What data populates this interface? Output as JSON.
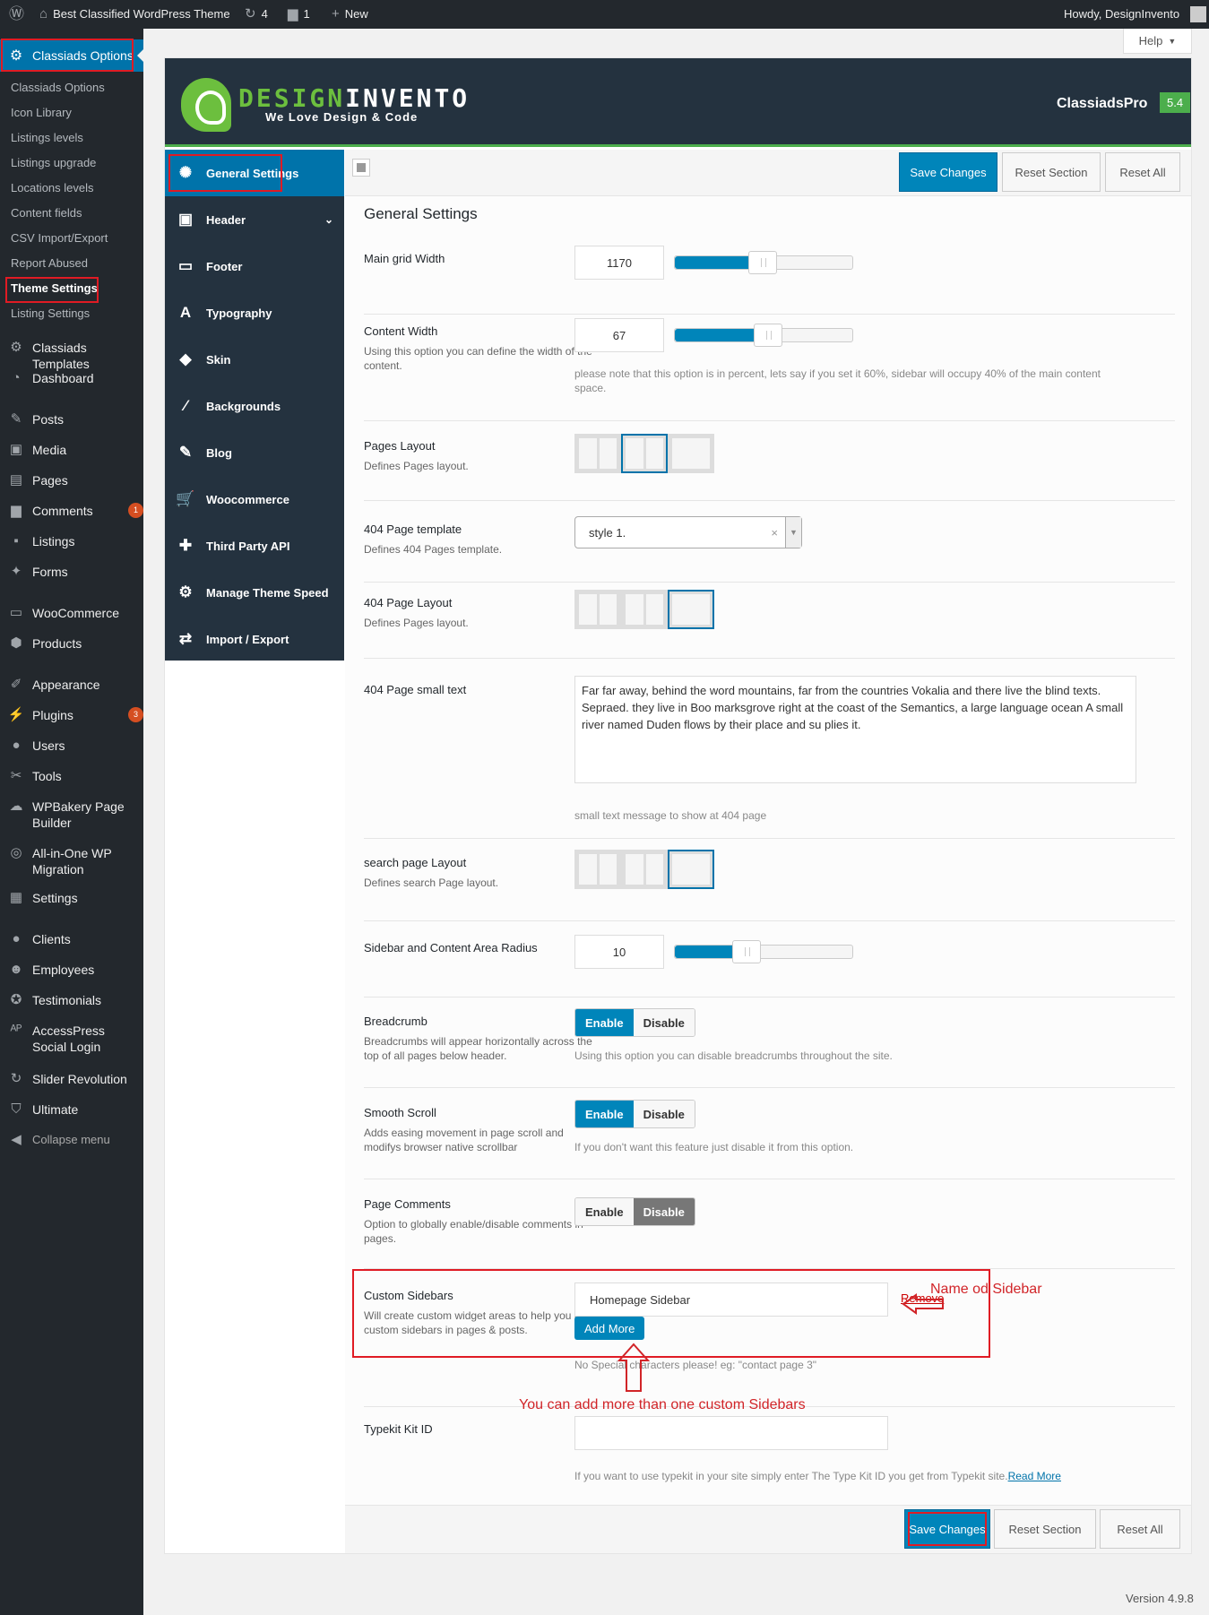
{
  "adminbar": {
    "site_name": "Best Classified WordPress Theme",
    "updates_count": "4",
    "comments_count": "1",
    "new_label": "New",
    "howdy": "Howdy, DesignInvento"
  },
  "help_label": "Help",
  "sidebar": {
    "top_label": "Classiads Options",
    "submenu": [
      "Classiads Options",
      "Icon Library",
      "Listings levels",
      "Listings upgrade",
      "Locations levels",
      "Content fields",
      "CSV Import/Export",
      "Report Abused",
      "Theme Settings",
      "Listing Settings"
    ],
    "menu": [
      {
        "label": "Classiads Templates",
        "icon": "gear-icon"
      },
      {
        "label": "Dashboard",
        "icon": "dashboard-icon"
      },
      {
        "label": "Posts",
        "icon": "pin-icon"
      },
      {
        "label": "Media",
        "icon": "media-icon"
      },
      {
        "label": "Pages",
        "icon": "page-icon"
      },
      {
        "label": "Comments",
        "icon": "comment-icon",
        "badge": "1"
      },
      {
        "label": "Listings",
        "icon": "listings-icon"
      },
      {
        "label": "Forms",
        "icon": "forms-icon"
      },
      {
        "label": "WooCommerce",
        "icon": "woo-icon"
      },
      {
        "label": "Products",
        "icon": "box-icon"
      },
      {
        "label": "Appearance",
        "icon": "brush-icon"
      },
      {
        "label": "Plugins",
        "icon": "plug-icon",
        "badge": "3"
      },
      {
        "label": "Users",
        "icon": "user-icon"
      },
      {
        "label": "Tools",
        "icon": "wrench-icon"
      },
      {
        "label": "WPBakery Page Builder",
        "icon": "cloud-icon"
      },
      {
        "label": "All-in-One WP Migration",
        "icon": "migration-icon"
      },
      {
        "label": "Settings",
        "icon": "settings-icon"
      },
      {
        "label": "Clients",
        "icon": "user-icon"
      },
      {
        "label": "Employees",
        "icon": "group-icon"
      },
      {
        "label": "Testimonials",
        "icon": "award-icon"
      },
      {
        "label": "AccessPress Social Login",
        "icon": "ap-icon"
      },
      {
        "label": "Slider Revolution",
        "icon": "refresh-icon"
      },
      {
        "label": "Ultimate",
        "icon": "shield-icon"
      },
      {
        "label": "Collapse menu",
        "icon": "collapse-icon"
      }
    ]
  },
  "panel": {
    "logo_green": "DESIGN",
    "logo_white": "INVENTO",
    "tagline": "We Love Design & Code",
    "theme_name": "ClassiadsPro",
    "theme_version": "5.4",
    "nav": [
      "General Settings",
      "Header",
      "Footer",
      "Typography",
      "Skin",
      "Backgrounds",
      "Blog",
      "Woocommerce",
      "Third Party API",
      "Manage Theme Speed",
      "Import / Export"
    ],
    "save_label": "Save Changes",
    "reset_section_label": "Reset Section",
    "reset_all_label": "Reset All",
    "section_title": "General Settings"
  },
  "settings": {
    "grid": {
      "label": "Main grid Width",
      "value": "1170",
      "fraction": 0.49
    },
    "content_width": {
      "label": "Content Width",
      "desc": "Using this option you can define the width of the content.",
      "value": "67",
      "fraction": 0.52,
      "note": "please note that this option is in percent, lets say if you set it 60%, sidebar will occupy 40% of the main content space."
    },
    "pages_layout": {
      "label": "Pages Layout",
      "desc": "Defines Pages layout.",
      "selected": 2
    },
    "page404_template": {
      "label": "404 Page template",
      "desc": "Defines 404 Pages template.",
      "value": "style 1.",
      "clear": "×",
      "arrow": "▼"
    },
    "page404_layout": {
      "label": "404 Page Layout",
      "desc": "Defines Pages layout.",
      "selected": 3
    },
    "page404_text": {
      "label": "404 Page small text",
      "value": "Far far away, behind the word mountains, far from the countries Vokalia and there live the blind texts. Sepraed. they live in Boo marksgrove right at the coast of the Semantics, a large language ocean A small river named Duden flows by their place and su plies it.",
      "note": "small text message to show at 404 page"
    },
    "search_layout": {
      "label": "search page Layout",
      "desc": "Defines search Page layout.",
      "selected": 3
    },
    "radius": {
      "label": "Sidebar and Content Area Radius",
      "value": "10",
      "fraction": 0.4
    },
    "breadcrumb": {
      "label": "Breadcrumb",
      "desc": "Breadcrumbs will appear horizontally across the top of all pages below header.",
      "enable": "Enable",
      "disable": "Disable",
      "note": "Using this option you can disable breadcrumbs throughout the site.",
      "state": "enable"
    },
    "smooth_scroll": {
      "label": "Smooth Scroll",
      "desc": "Adds easing movement in page scroll and modifys browser native scrollbar",
      "enable": "Enable",
      "disable": "Disable",
      "note": "If you don't want this feature just disable it from this option.",
      "state": "enable"
    },
    "page_comments": {
      "label": "Page Comments",
      "desc": "Option to globally enable/disable comments in pages.",
      "enable": "Enable",
      "disable": "Disable",
      "state": "disable"
    },
    "custom_sidebars": {
      "label": "Custom Sidebars",
      "desc": "Will create custom widget areas to help you make custom sidebars in pages & posts.",
      "value": "Homepage Sidebar",
      "remove": "Remove",
      "add_more": "Add More",
      "note": "No Special characters please! eg: \"contact page 3\""
    },
    "typekit": {
      "label": "Typekit Kit ID",
      "value": "",
      "note": "If you want to use typekit in your site simply enter The Type Kit ID you get from Typekit site.",
      "read_more": "Read More"
    }
  },
  "annotations": {
    "name_of_sidebar": "Name od Sidebar",
    "add_more_hint": "You can add more than one custom Sidebars"
  },
  "footer": {
    "wp_version": "Version 4.9.8"
  },
  "colors": {
    "accent": "#0085ba",
    "header_bg": "#24323f",
    "brand_green": "#6cbf3e",
    "highlight_red": "#e01b24"
  }
}
